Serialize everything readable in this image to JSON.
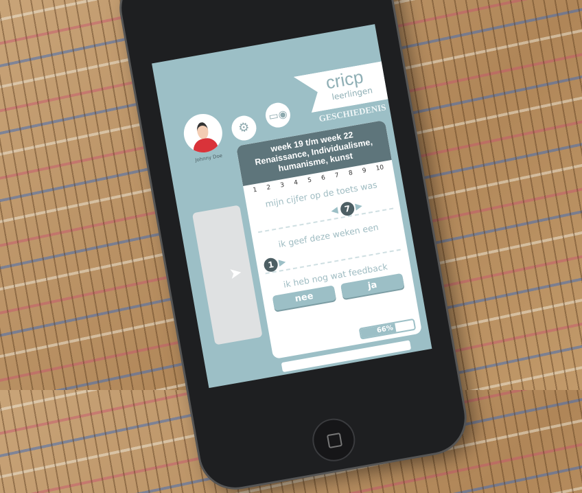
{
  "user": {
    "name": "Johnny Doe"
  },
  "icons": {
    "settings": "gears-icon",
    "media": "camera-icon"
  },
  "brand": {
    "name": "cricp",
    "sub": "leerlingen"
  },
  "subject": "GESCHIEDENIS",
  "card": {
    "title_lines": [
      "week 19 t/m week 22",
      "Renaissance, Individualisme,",
      "humanisme, kunst"
    ],
    "scale": [
      "1",
      "2",
      "3",
      "4",
      "5",
      "6",
      "7",
      "8",
      "9",
      "10"
    ],
    "q1": {
      "label": "mijn cijfer op de toets was",
      "value": "7"
    },
    "q2": {
      "label": "ik geef deze weken een",
      "value": "1"
    },
    "q3": {
      "label": "ik heb nog wat feedback",
      "no": "nee",
      "yes": "ja"
    },
    "progress": {
      "label": "66%",
      "value": 66
    }
  },
  "colors": {
    "screen": "#9cbfc6",
    "header": "#5e757b",
    "avatar_shirt": "#d9333a"
  }
}
